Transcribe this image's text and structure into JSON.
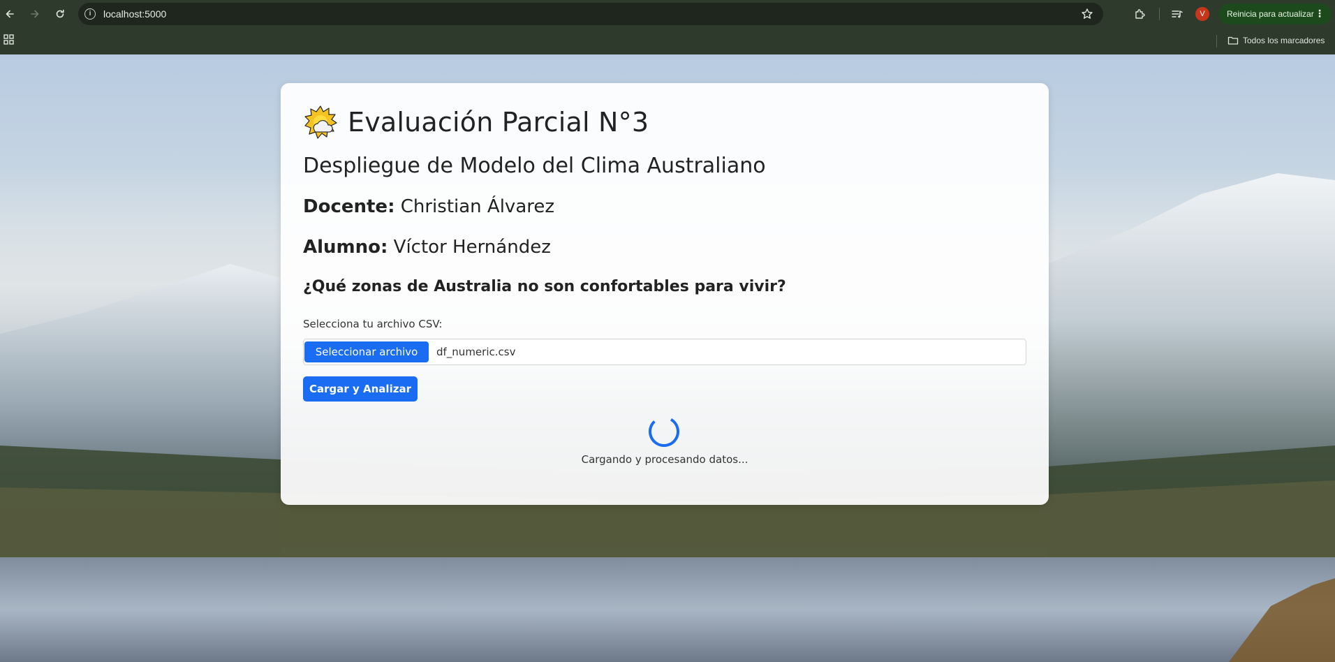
{
  "browser": {
    "url": "localhost:5000",
    "profile_initial": "V",
    "update_button_label": "Reinicia para actualizar",
    "bookmarks_label": "Todos los marcadores"
  },
  "page": {
    "title": "Evaluación Parcial N°3",
    "subtitle": "Despliegue de Modelo del Clima Australiano",
    "teacher_label": "Docente:",
    "teacher_name": "Christian Álvarez",
    "student_label": "Alumno:",
    "student_name": "Víctor Hernández",
    "question": "¿Qué zonas de Australia no son confortables para vivir?",
    "file_label": "Selecciona tu archivo CSV:",
    "file_button_label": "Seleccionar archivo",
    "file_name": "df_numeric.csv",
    "submit_label": "Cargar y Analizar",
    "loading_text": "Cargando y procesando datos..."
  },
  "colors": {
    "primary": "#1a6cf2",
    "chrome_bg": "#2e3a2c",
    "update_bg": "#1d4a1d",
    "avatar_bg": "#c5361a"
  },
  "icons": [
    "back-arrow-icon",
    "forward-arrow-icon",
    "reload-icon",
    "site-info-icon",
    "star-icon",
    "extensions-icon",
    "media-queue-icon",
    "apps-grid-icon",
    "folder-icon",
    "sun-cloud-icon",
    "loading-spinner-icon"
  ]
}
